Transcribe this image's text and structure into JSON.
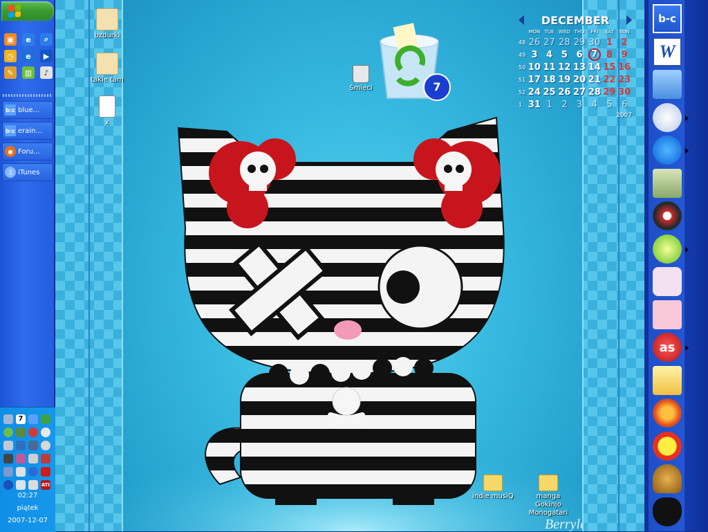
{
  "taskbar": {
    "start_icon": "windows-logo-icon",
    "quicklaunch": [
      {
        "icon": "media-player-icon",
        "color": "#f08a24"
      },
      {
        "icon": "internet-explorer-icon",
        "color": "#2b7de9"
      },
      {
        "icon": "search-icon",
        "color": "#2b7de9"
      },
      {
        "icon": "clock-icon",
        "color": "#f0b020"
      },
      {
        "icon": "internet-explorer-icon",
        "color": "#1d6fd8"
      },
      {
        "icon": "media-play-icon",
        "color": "#1256c2"
      },
      {
        "icon": "pencil-icon",
        "color": "#e0a030"
      },
      {
        "icon": "filmstrip-icon",
        "color": "#6fbf3a"
      },
      {
        "icon": "music-note-icon",
        "color": "#e4e4e4"
      }
    ],
    "tasks": [
      {
        "label": "blue...",
        "icon": "bc-icon",
        "color": "#5aa0ff"
      },
      {
        "label": "erain...",
        "icon": "bc-icon",
        "color": "#5aa0ff"
      },
      {
        "label": "Foru...",
        "icon": "firefox-icon",
        "color": "#e8701a"
      },
      {
        "label": "iTunes",
        "icon": "itunes-icon",
        "color": "#8ab8ff"
      }
    ],
    "tray": {
      "time": "02:27",
      "day": "piątek",
      "date": "2007-12-07",
      "icons": [
        "network-icon",
        "calendar-7-icon",
        "bc-icon",
        "security-icon",
        "media-icon",
        "monitor-icon",
        "antivirus-icon",
        "media-icon",
        "usb-icon",
        "messenger-icon",
        "network-icon",
        "media-icon",
        "camera-icon",
        "paint-icon",
        "printer-icon",
        "network-icon",
        "audio-icon",
        "tools-icon",
        "info-icon",
        "ati-icon",
        "bluetooth-icon",
        "display-icon",
        "volume-icon",
        "ati-icon"
      ],
      "cal_badge": "7",
      "ati_label": "ATI"
    }
  },
  "desktop": {
    "icons": [
      {
        "label": "bzdurki",
        "icon": "folder-heart-icon"
      },
      {
        "label": "takie tam",
        "icon": "folder-cherry-icon"
      },
      {
        "label": "x",
        "icon": "document-icon"
      },
      {
        "label": "Śmieci",
        "icon": "trash-icon"
      },
      {
        "label": "indie musiQ",
        "icon": "folder-icon"
      },
      {
        "label": "manga Gokinjo Monogatari",
        "icon": "folder-icon"
      }
    ],
    "recycle_bin_count": "7",
    "watermark": "Berryland"
  },
  "calendar": {
    "month": "DECEMBER",
    "year": "2007",
    "day_headers": [
      "MON",
      "TUE",
      "WED",
      "THU",
      "FRI",
      "SAT",
      "SUN"
    ],
    "weeks": [
      {
        "wk": "48",
        "days": [
          "26",
          "27",
          "28",
          "29",
          "30",
          "1",
          "2"
        ]
      },
      {
        "wk": "49",
        "days": [
          "3",
          "4",
          "5",
          "6",
          "7",
          "8",
          "9"
        ]
      },
      {
        "wk": "50",
        "days": [
          "10",
          "11",
          "12",
          "13",
          "14",
          "15",
          "16"
        ]
      },
      {
        "wk": "51",
        "days": [
          "17",
          "18",
          "19",
          "20",
          "21",
          "22",
          "23"
        ]
      },
      {
        "wk": "52",
        "days": [
          "24",
          "25",
          "26",
          "27",
          "28",
          "29",
          "30"
        ]
      },
      {
        "wk": "1",
        "days": [
          "31",
          "1",
          "2",
          "3",
          "4",
          "5",
          "6"
        ]
      }
    ]
  },
  "dock": {
    "items": [
      {
        "icon": "bc-icon",
        "label": "b-c"
      },
      {
        "icon": "word-icon",
        "label": "W"
      },
      {
        "icon": "my-computer-icon"
      },
      {
        "icon": "itunes-icon"
      },
      {
        "icon": "internet-explorer-icon"
      },
      {
        "icon": "folder-icon"
      },
      {
        "icon": "itunes-disc-icon"
      },
      {
        "icon": "limewire-icon"
      },
      {
        "icon": "unicorn-icon"
      },
      {
        "icon": "folder-heart-icon"
      },
      {
        "icon": "lastfm-icon",
        "label": "as"
      },
      {
        "icon": "mail-folder-icon"
      },
      {
        "icon": "firefox-icon"
      },
      {
        "icon": "smiley-sun-icon"
      },
      {
        "icon": "leopard-heart-icon"
      },
      {
        "icon": "black-cat-icon"
      }
    ]
  }
}
